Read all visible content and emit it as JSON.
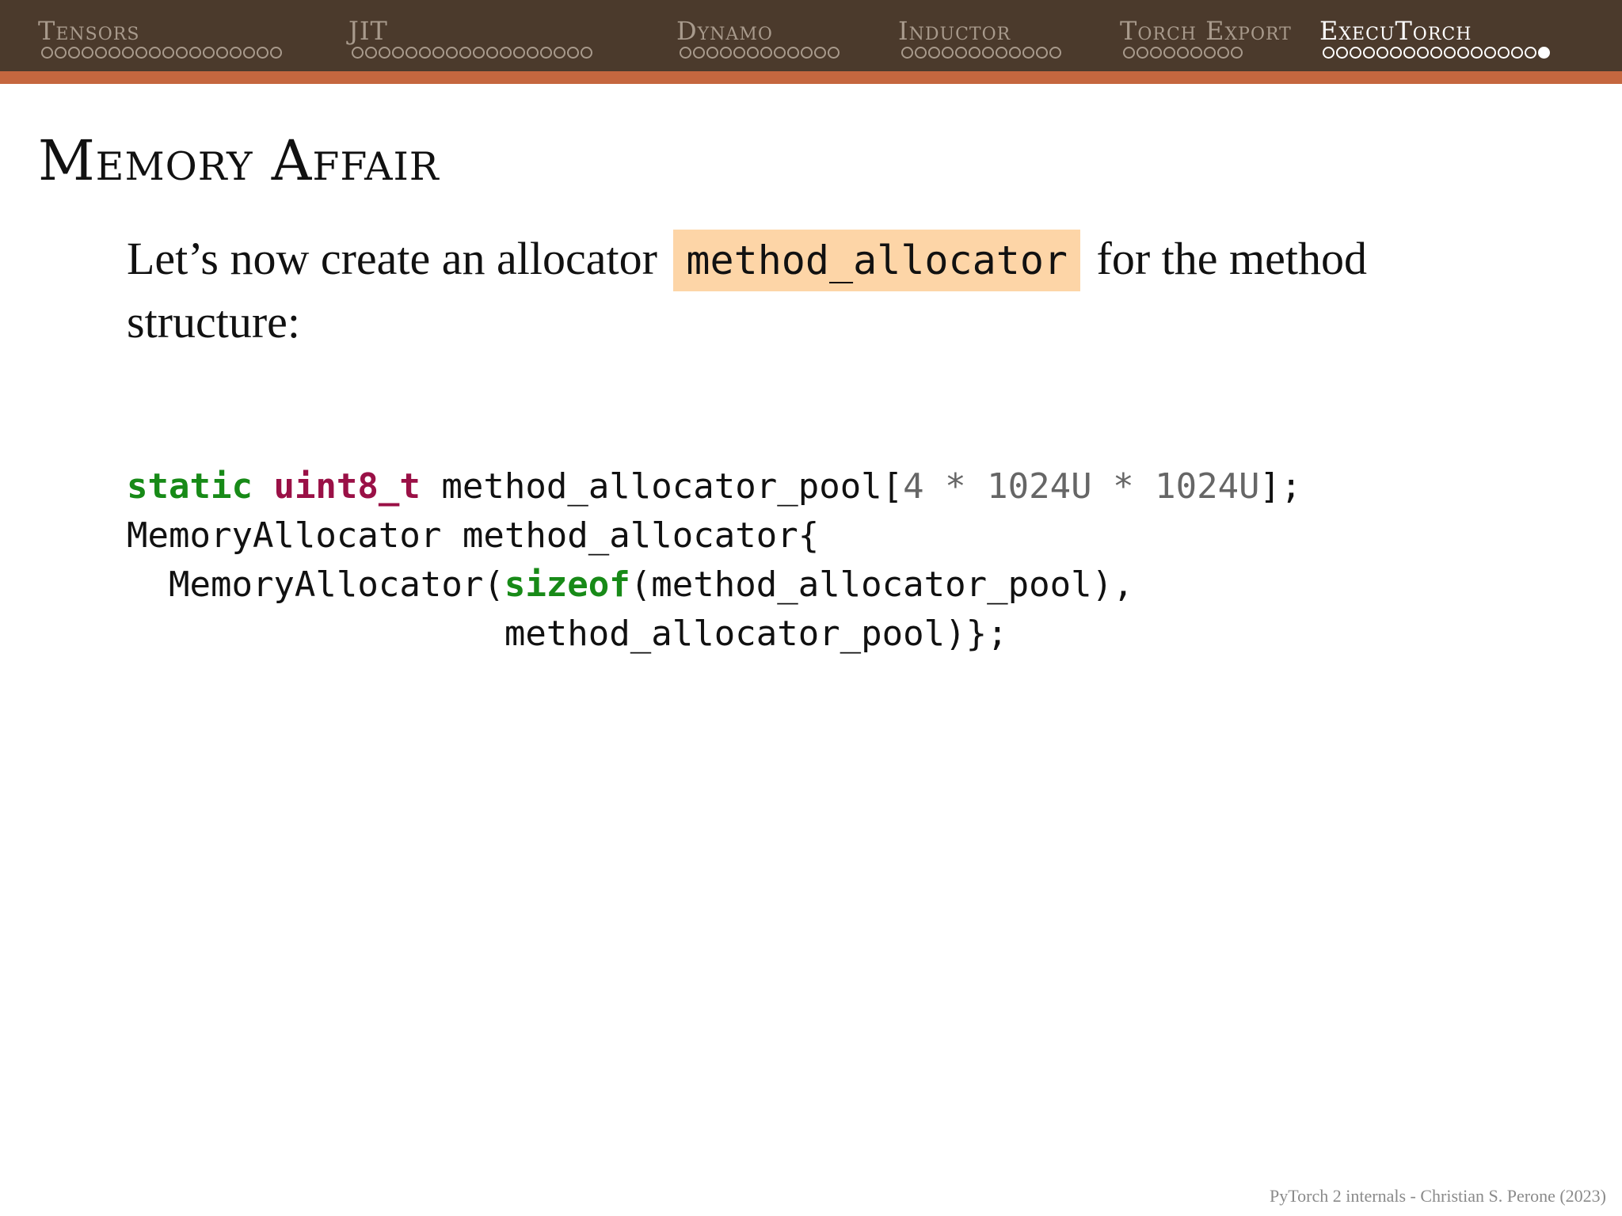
{
  "nav": {
    "sections": [
      {
        "label": "Tensors",
        "dots": 18,
        "active": false
      },
      {
        "label": "JIT",
        "dots": 18,
        "active": false
      },
      {
        "label": "Dynamo",
        "dots": 12,
        "active": false
      },
      {
        "label": "Inductor",
        "dots": 12,
        "active": false
      },
      {
        "label": "Torch Export",
        "dots": 9,
        "active": false
      },
      {
        "label": "ExecuTorch",
        "dots": 17,
        "active": true,
        "current_slide": 17
      }
    ]
  },
  "colors": {
    "topbar": "#4b3a2c",
    "stripe": "#c5673f",
    "highlight": "#fdd5a7",
    "keyword": "#178a17",
    "type": "#9a1046",
    "number": "#666666"
  },
  "frame": {
    "title": "Memory Affair",
    "text_before": "Let’s now create an allocator",
    "highlight": "method_allocator",
    "text_after": "for the method structure:"
  },
  "code": {
    "l1_kw": "static",
    "l1_type": "uint8_t",
    "l1_a": " method_allocator_pool[",
    "l1_num1": "4",
    "l1_op1": " * ",
    "l1_num2": "1024U",
    "l1_op2": " * ",
    "l1_num3": "1024U",
    "l1_b": "];",
    "l2": "MemoryAllocator method_allocator{",
    "l3_a": "  MemoryAllocator(",
    "l3_kw": "sizeof",
    "l3_b": "(method_allocator_pool),",
    "l4": "                  method_allocator_pool)};"
  },
  "footer": "PyTorch 2 internals - Christian S. Perone (2023)"
}
